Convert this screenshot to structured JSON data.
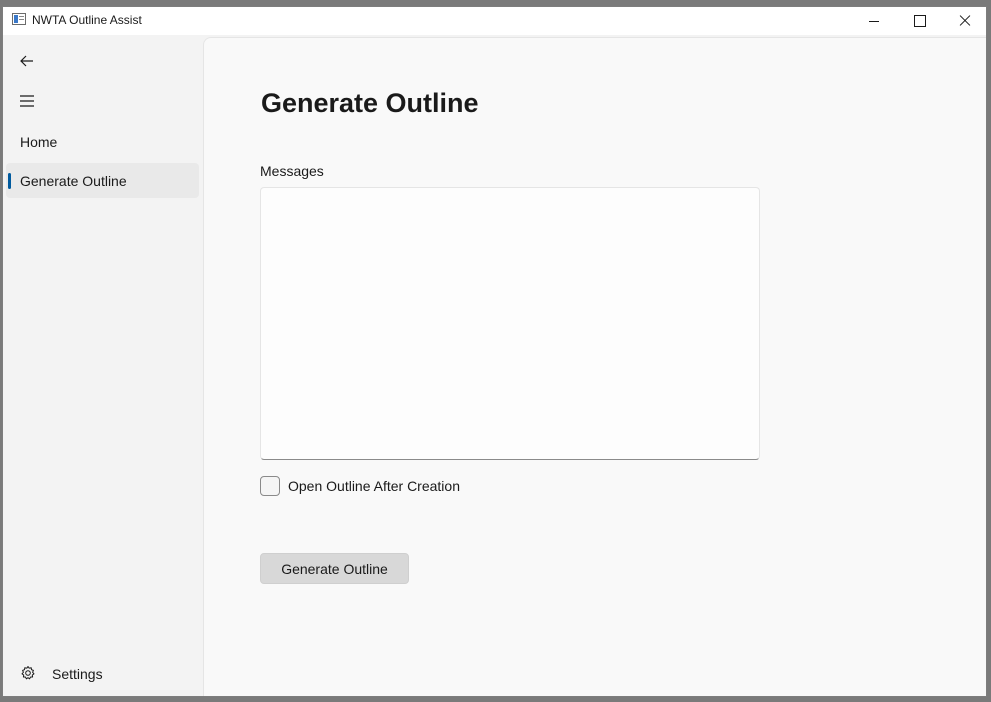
{
  "window": {
    "title": "NWTA Outline Assist"
  },
  "nav": {
    "items": [
      {
        "label": "Home",
        "selected": false
      },
      {
        "label": "Generate Outline",
        "selected": true
      }
    ],
    "settings_label": "Settings",
    "accent_color": "#005a9e"
  },
  "page": {
    "title": "Generate Outline",
    "messages_label": "Messages",
    "messages_value": "",
    "checkbox_label": "Open Outline After Creation",
    "checkbox_checked": false,
    "button_label": "Generate Outline"
  },
  "icons": {
    "app": "app-window-icon",
    "back": "back-arrow-icon",
    "menu": "hamburger-icon",
    "settings": "gear-icon"
  }
}
